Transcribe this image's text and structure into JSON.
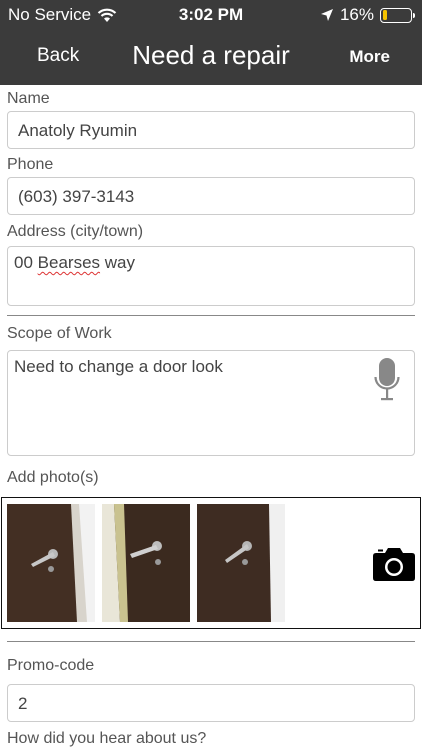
{
  "status": {
    "carrier": "No Service",
    "time": "3:02 PM",
    "battery": "16%",
    "battery_level": 0.16
  },
  "nav": {
    "back": "Back",
    "title": "Need a repair",
    "more": "More"
  },
  "form": {
    "name_label": "Name",
    "name_value": "Anatoly Ryumin",
    "phone_label": "Phone",
    "phone_value": "(603) 397-3143",
    "address_label": "Address (city/town)",
    "address_number": "00",
    "address_street": "Bearses",
    "address_suffix": "way",
    "scope_label": "Scope of Work",
    "scope_value": "Need to change a door look",
    "photos_label": "Add photo(s)",
    "promo_label": "Promo-code",
    "promo_value": "2",
    "hear_label": "How did you hear about us?"
  },
  "colors": {
    "nav_bg": "#3b3b3b",
    "battery": "#f5c400"
  }
}
